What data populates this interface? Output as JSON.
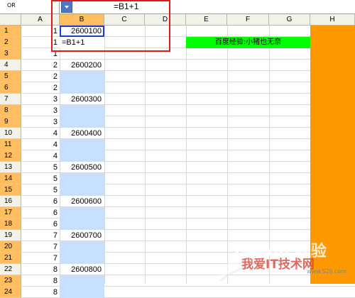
{
  "formula_bar": {
    "name_box": "OR",
    "formula": "=B1+1"
  },
  "columns": [
    "A",
    "B",
    "C",
    "D",
    "E",
    "F",
    "G",
    "H"
  ],
  "rows": [
    {
      "n": "1",
      "a": "1",
      "b": "2600100"
    },
    {
      "n": "2",
      "a": "1",
      "b": "=B1+1"
    },
    {
      "n": "3",
      "a": "1",
      "b": ""
    },
    {
      "n": "4",
      "a": "2",
      "b": "2600200"
    },
    {
      "n": "5",
      "a": "2",
      "b": ""
    },
    {
      "n": "6",
      "a": "2",
      "b": ""
    },
    {
      "n": "7",
      "a": "3",
      "b": "2600300"
    },
    {
      "n": "8",
      "a": "3",
      "b": ""
    },
    {
      "n": "9",
      "a": "3",
      "b": ""
    },
    {
      "n": "10",
      "a": "4",
      "b": "2600400"
    },
    {
      "n": "11",
      "a": "4",
      "b": ""
    },
    {
      "n": "12",
      "a": "4",
      "b": ""
    },
    {
      "n": "13",
      "a": "5",
      "b": "2600500"
    },
    {
      "n": "14",
      "a": "5",
      "b": ""
    },
    {
      "n": "15",
      "a": "5",
      "b": ""
    },
    {
      "n": "16",
      "a": "6",
      "b": "2600600"
    },
    {
      "n": "17",
      "a": "6",
      "b": ""
    },
    {
      "n": "18",
      "a": "6",
      "b": ""
    },
    {
      "n": "19",
      "a": "7",
      "b": "2600700"
    },
    {
      "n": "20",
      "a": "7",
      "b": ""
    },
    {
      "n": "21",
      "a": "7",
      "b": ""
    },
    {
      "n": "22",
      "a": "8",
      "b": "2600800"
    },
    {
      "n": "23",
      "a": "8",
      "b": ""
    },
    {
      "n": "24",
      "a": "8",
      "b": ""
    }
  ],
  "green_label": "百度经验:小猪也无奈",
  "watermark": {
    "line1": "Bai du 经验",
    "line2": "我爱IT技术网",
    "url": "www.52ij.com"
  },
  "colors": {
    "selected_header": "#ffbf60",
    "blue_fill": "#c7e0ff",
    "green_label": "#00ff00",
    "column_h_fill": "#ff9900",
    "highlight_box": "#e01a1a"
  }
}
